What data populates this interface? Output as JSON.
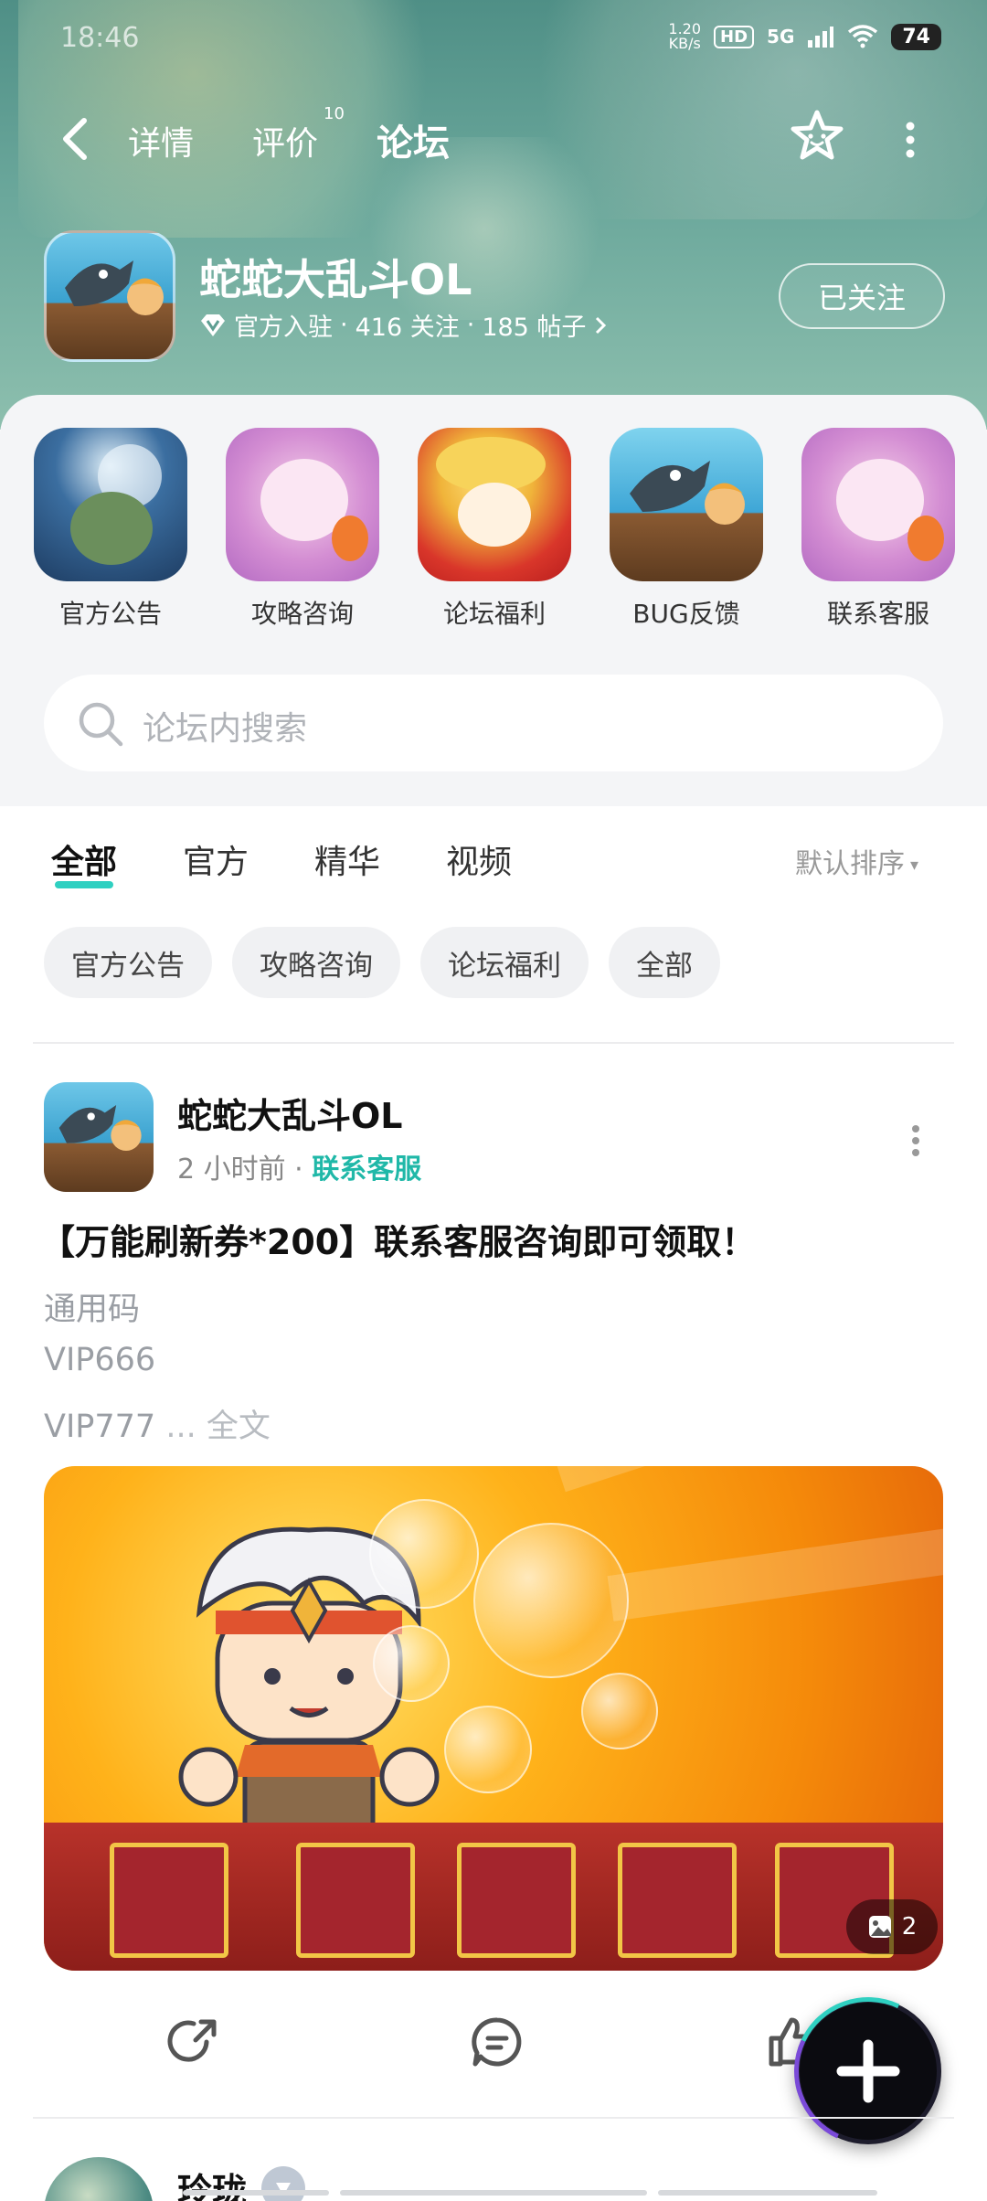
{
  "status": {
    "time": "18:46",
    "speed_value": "1.20",
    "speed_unit": "KB/s",
    "hd": "HD",
    "network": "5G",
    "battery": "74"
  },
  "nav": {
    "tabs": [
      {
        "label": "详情"
      },
      {
        "label": "评价",
        "badge": "10"
      },
      {
        "label": "论坛"
      }
    ],
    "active_tab": "论坛"
  },
  "app": {
    "name": "蛇蛇大乱斗OL",
    "badge": "官方入驻",
    "followers": "416 关注",
    "posts": "185 帖子",
    "follow_label": "已关注"
  },
  "shortcuts": [
    {
      "label": "官方公告",
      "icon": "announcement-art"
    },
    {
      "label": "攻略咨询",
      "icon": "guide-art"
    },
    {
      "label": "论坛福利",
      "icon": "welfare-art"
    },
    {
      "label": "BUG反馈",
      "icon": "bug-art"
    },
    {
      "label": "联系客服",
      "icon": "service-art"
    }
  ],
  "search": {
    "placeholder": "论坛内搜索"
  },
  "filter_tabs": [
    {
      "label": "全部"
    },
    {
      "label": "官方"
    },
    {
      "label": "精华"
    },
    {
      "label": "视频"
    }
  ],
  "sort_label": "默认排序",
  "chips": [
    {
      "label": "官方公告"
    },
    {
      "label": "攻略咨询"
    },
    {
      "label": "论坛福利"
    },
    {
      "label": "全部"
    }
  ],
  "post": {
    "author": "蛇蛇大乱斗OL",
    "time": "2 小时前",
    "separator": " · ",
    "category": "联系客服",
    "title": "【万能刷新券*200】联系客服咨询即可领取！",
    "lines": [
      "通用码",
      "VIP666",
      "VIP777"
    ],
    "ellipsis": " ... ",
    "full_text_label": "全文",
    "image_count": "2"
  },
  "next_post": {
    "author": "玲珑"
  },
  "colors": {
    "accent": "#2fd0c1",
    "category": "#20b8a8"
  }
}
